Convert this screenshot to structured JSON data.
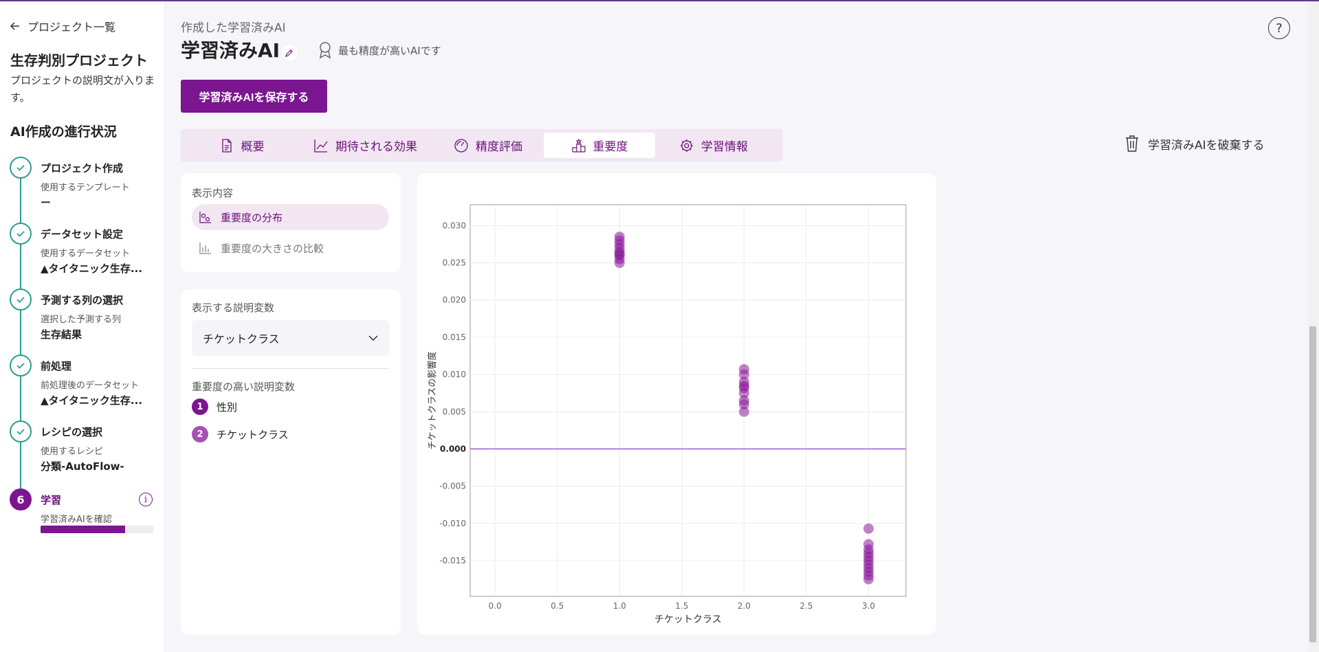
{
  "sidebar": {
    "back_label": "プロジェクト一覧",
    "project_title": "生存判別プロジェクト",
    "project_desc": "プロジェクトの説明文が入ります。",
    "progress_title": "AI作成の進行状況",
    "steps": [
      {
        "name": "プロジェクト作成",
        "sub": "使用するテンプレート",
        "value": "ー"
      },
      {
        "name": "データセット設定",
        "sub": "使用するデータセット",
        "value": "▲タイタニック生存..."
      },
      {
        "name": "予測する列の選択",
        "sub": "選択した予測する列",
        "value": "生存結果"
      },
      {
        "name": "前処理",
        "sub": "前処理後のデータセット",
        "value": "▲タイタニック生存..."
      },
      {
        "name": "レシピの選択",
        "sub": "使用するレシピ",
        "value": "分類-AutoFlow-"
      },
      {
        "number": "6",
        "name": "学習",
        "sub": "学習済みAIを確認",
        "progress": 0.75
      }
    ]
  },
  "header": {
    "subtitle": "作成した学習済みAI",
    "title": "学習済みAI",
    "badge": "最も精度が高いAIです",
    "save_label": "学習済みAIを保存する",
    "discard_label": "学習済みAIを破棄する"
  },
  "tabs": [
    {
      "label": "概要",
      "icon": "document-icon"
    },
    {
      "label": "期待される効果",
      "icon": "trend-chart-icon"
    },
    {
      "label": "精度評価",
      "icon": "gauge-icon"
    },
    {
      "label": "重要度",
      "icon": "podium-icon",
      "active": true
    },
    {
      "label": "学習情報",
      "icon": "gear-icon"
    }
  ],
  "display_panel": {
    "label": "表示内容",
    "options": [
      {
        "label": "重要度の分布",
        "active": true
      },
      {
        "label": "重要度の大きさの比較",
        "active": false
      }
    ]
  },
  "variable_panel": {
    "label": "表示する説明変数",
    "selected": "チケットクラス",
    "ranking_label": "重要度の高い説明変数",
    "ranking": [
      {
        "rank": "1",
        "name": "性別",
        "color": "#7b1590"
      },
      {
        "rank": "2",
        "name": "チケットクラス",
        "color": "#a452b3"
      }
    ]
  },
  "chart_data": {
    "type": "scatter",
    "xlabel": "チケットクラス",
    "ylabel": "チケットクラスの影響度",
    "xlim": [
      -0.2,
      3.3
    ],
    "ylim": [
      -0.0198,
      0.0328
    ],
    "xticks": [
      "0.0",
      "0.5",
      "1.0",
      "1.5",
      "2.0",
      "2.5",
      "3.0"
    ],
    "yticks": [
      "0.030",
      "0.025",
      "0.020",
      "0.015",
      "0.010",
      "0.005",
      "0.000",
      "-0.005",
      "-0.010",
      "-0.015"
    ],
    "grid": true,
    "zero_line_color": "#9c5bd0",
    "marker_color": "#8a1a9b",
    "series": [
      {
        "x": 1.0,
        "y": [
          0.0285,
          0.028,
          0.0275,
          0.027,
          0.0265,
          0.0262,
          0.026,
          0.0255,
          0.025
        ]
      },
      {
        "x": 2.0,
        "y": [
          0.0107,
          0.01,
          0.009,
          0.0085,
          0.0082,
          0.0075,
          0.0065,
          0.006,
          0.005
        ]
      },
      {
        "x": 3.0,
        "y": [
          -0.0107,
          -0.0128,
          -0.0135,
          -0.014,
          -0.0145,
          -0.015,
          -0.0155,
          -0.016,
          -0.0165,
          -0.017,
          -0.0175
        ]
      }
    ]
  }
}
